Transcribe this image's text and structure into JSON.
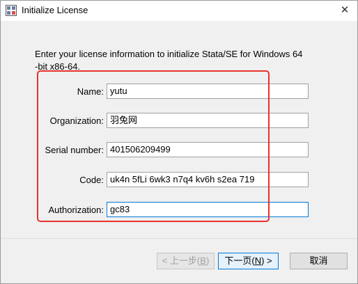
{
  "window": {
    "title": "Initialize License",
    "close_glyph": "✕"
  },
  "intro": {
    "line1": "Enter your license information to initialize Stata/SE for Windows 64",
    "line2": "-bit x86-64."
  },
  "form": {
    "name": {
      "label": "Name:",
      "value": "yutu"
    },
    "organization": {
      "label": "Organization:",
      "value": "羽兔网"
    },
    "serial": {
      "label": "Serial number:",
      "value": "401506209499"
    },
    "code": {
      "label": "Code:",
      "value": "uk4n 5fLi 6wk3 n7q4 kv6h s2ea 719"
    },
    "authorization": {
      "label": "Authorization:",
      "value": "gc83"
    }
  },
  "buttons": {
    "back": {
      "prefix": "< 上一步(",
      "mnemonic": "B",
      "suffix": ")"
    },
    "next": {
      "prefix": "下一页(",
      "mnemonic": "N",
      "suffix": ") >"
    },
    "cancel": {
      "label": "取消"
    }
  },
  "colors": {
    "highlight": "#e8322c",
    "focus": "#0078d7"
  },
  "icons": {
    "app": "stata-app-icon",
    "close": "close-icon"
  }
}
